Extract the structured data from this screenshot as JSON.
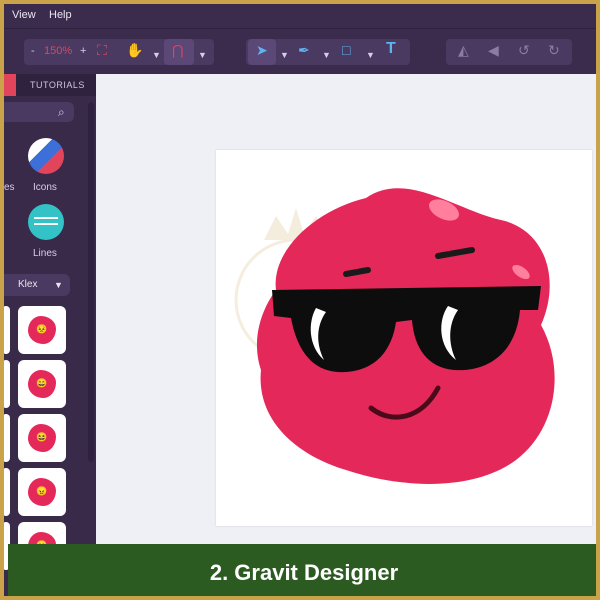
{
  "menu": {
    "view": "View",
    "help": "Help"
  },
  "toolbar": {
    "zoom": "150%",
    "minus": "-",
    "plus": "+",
    "tools": [
      "expand-icon",
      "hand-icon",
      "magnet-icon",
      "pointer-icon",
      "pen-icon",
      "rectangle-icon",
      "text-icon",
      "triangle-icon",
      "arrow-icon",
      "undo-icon",
      "redo-icon"
    ]
  },
  "sidebar": {
    "tab": "TUTORIALS",
    "categories": [
      {
        "label": "es"
      },
      {
        "label": "Icons"
      },
      {
        "label": "Lines"
      }
    ],
    "dropdown": "Klex",
    "tiles": [
      "😣",
      "😄",
      "😆",
      "😠",
      "😐"
    ]
  },
  "caption": "2. Gravit Designer",
  "colors": {
    "blob": "#e5285a",
    "accent": "#e2445c",
    "caption_bg": "#2c5b22",
    "ui_bg": "#3b2b4d"
  }
}
